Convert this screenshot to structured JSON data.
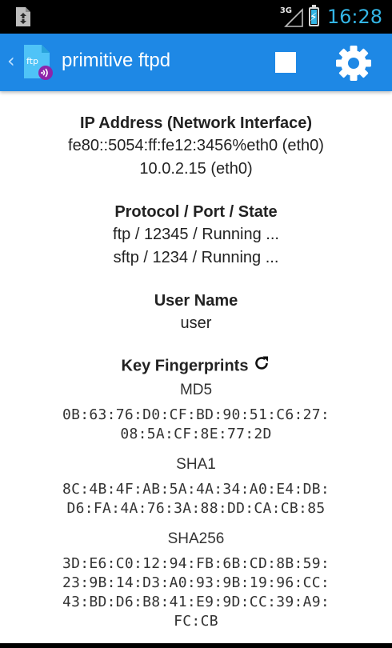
{
  "status": {
    "network": "3G",
    "time": "16:28"
  },
  "app": {
    "title": "primitive ftpd",
    "icon_label": "ftp"
  },
  "icons": {
    "back": "chevron-left-icon",
    "stop": "stop-icon",
    "settings": "gear-icon",
    "refresh": "refresh-icon",
    "download": "download-notification-icon"
  },
  "colors": {
    "actionbar": "#1e88e5",
    "clock": "#33b5e5",
    "statusbar": "#000000"
  },
  "ip": {
    "heading": "IP Address (Network Interface)",
    "values": [
      "fe80::5054:ff:fe12:3456%eth0 (eth0)",
      "10.0.2.15 (eth0)"
    ]
  },
  "protocol": {
    "heading": "Protocol / Port / State",
    "values": [
      "ftp / 12345 / Running ...",
      "sftp / 1234 / Running ..."
    ]
  },
  "user": {
    "heading": "User Name",
    "value": "user"
  },
  "keys": {
    "heading": "Key Fingerprints",
    "md5": {
      "label": "MD5",
      "lines": [
        "0B:63:76:D0:CF:BD:90:51:C6:27:",
        "08:5A:CF:8E:77:2D"
      ]
    },
    "sha1": {
      "label": "SHA1",
      "lines": [
        "8C:4B:4F:AB:5A:4A:34:A0:E4:DB:",
        "D6:FA:4A:76:3A:88:DD:CA:CB:85"
      ]
    },
    "sha256": {
      "label": "SHA256",
      "lines": [
        "3D:E6:C0:12:94:FB:6B:CD:8B:59:",
        "23:9B:14:D3:A0:93:9B:19:96:CC:",
        "43:BD:D6:B8:41:E9:9D:CC:39:A9:",
        "FC:CB"
      ]
    }
  }
}
